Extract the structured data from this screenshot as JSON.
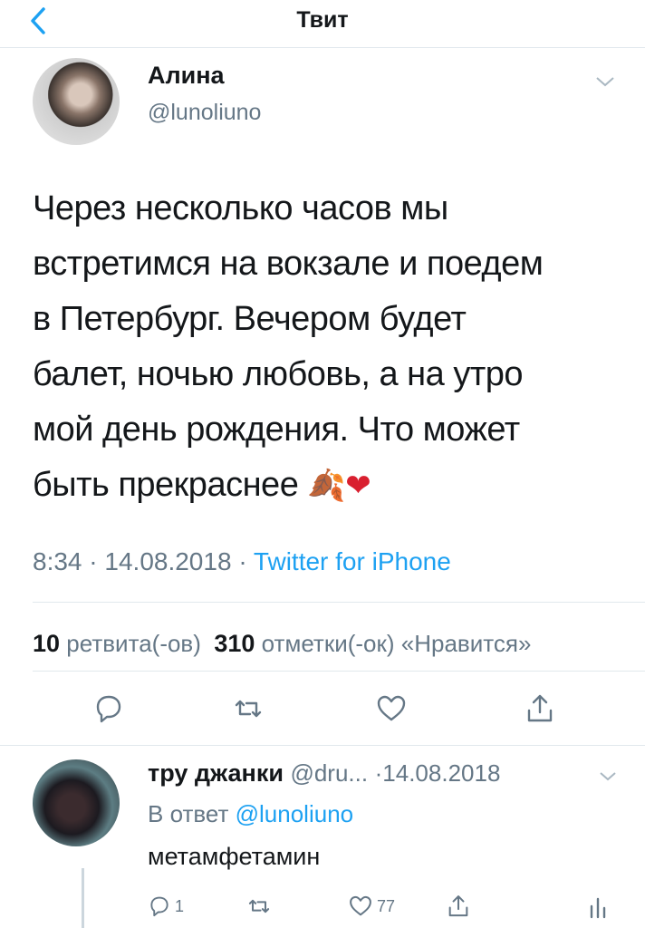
{
  "nav": {
    "title": "Твит"
  },
  "tweet": {
    "author_name": "Алина",
    "author_handle": "@lunoliuno",
    "text_lines": [
      "Через несколько часов мы",
      "встретимся на вокзале и поедем",
      "в Петербург. Вечером будет",
      "балет, ночью любовь, а на утро",
      "мой день рождения. Что может",
      "быть прекраснее"
    ],
    "emoji": "🍂❤",
    "time": "8:34",
    "date": "14.08.2018",
    "separator": "·",
    "source": "Twitter for iPhone",
    "retweets_count": "10",
    "retweets_label": "ретвита(-ов)",
    "likes_count": "310",
    "likes_label": "отметки(-ок) «Нравится»"
  },
  "reply": {
    "name": "тру джанки",
    "handle": "@dru...",
    "date": "·14.08.2018",
    "reply_prefix": "В ответ",
    "reply_to": "@lunoliuno",
    "text": "метамфетамин",
    "reply_count": "1",
    "like_count": "77"
  },
  "colors": {
    "link": "#1da1f2",
    "secondary": "#657786",
    "divider": "#e1e8ed"
  },
  "icons": [
    "back-chevron-icon",
    "caret-down-icon",
    "reply-icon",
    "retweet-icon",
    "like-icon",
    "share-icon",
    "analytics-icon"
  ]
}
